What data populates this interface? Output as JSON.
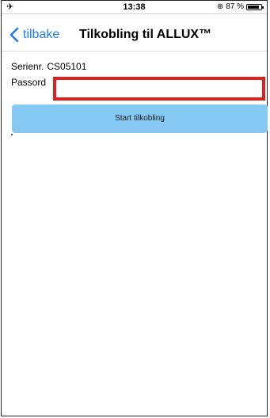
{
  "status_bar": {
    "time": "13:38",
    "battery_text": "87 %",
    "battery_level": 0.87
  },
  "nav": {
    "back_label": "tilbake",
    "title": "Tilkobling til ALLUX™"
  },
  "form": {
    "serial_label": "Serienr.",
    "serial_value": "CS05101",
    "password_label": "Passord",
    "password_value": "",
    "start_button": "Start tilkobling"
  },
  "colors": {
    "accent": "#1e7cf2",
    "button_bg": "#87c9f5",
    "highlight": "#e01f1f"
  }
}
